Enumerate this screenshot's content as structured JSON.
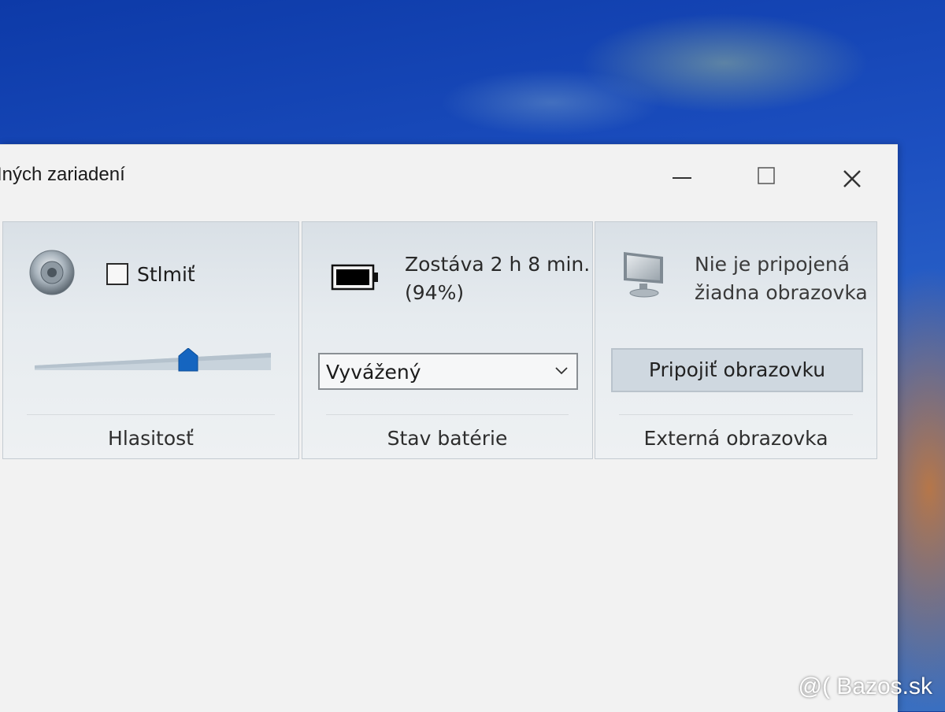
{
  "window": {
    "title": "Iných zariadení",
    "buttons": {
      "minimize": "minimize-icon",
      "maximize": "maximize-icon",
      "close": "close-icon"
    }
  },
  "volume": {
    "icon": "speaker-icon",
    "mute_label": "Stlmiť",
    "muted": false,
    "level": 0.65,
    "title": "Hlasitosť"
  },
  "battery": {
    "icon": "battery-icon",
    "remaining": "Zostáva 2 h 8 min.",
    "percent": "(94%)",
    "plan": "Vyvážený",
    "title": "Stav batérie"
  },
  "display": {
    "icon": "monitor-icon",
    "status_line1": "Nie je pripojená",
    "status_line2": "žiadna obrazovka",
    "connect_label": "Pripojiť obrazovku",
    "title": "Externá obrazovka"
  },
  "watermark": "@( Bazos.sk",
  "colors": {
    "accent": "#1f6fc6",
    "panel": "#e6ebef",
    "window": "#f2f2f2"
  }
}
